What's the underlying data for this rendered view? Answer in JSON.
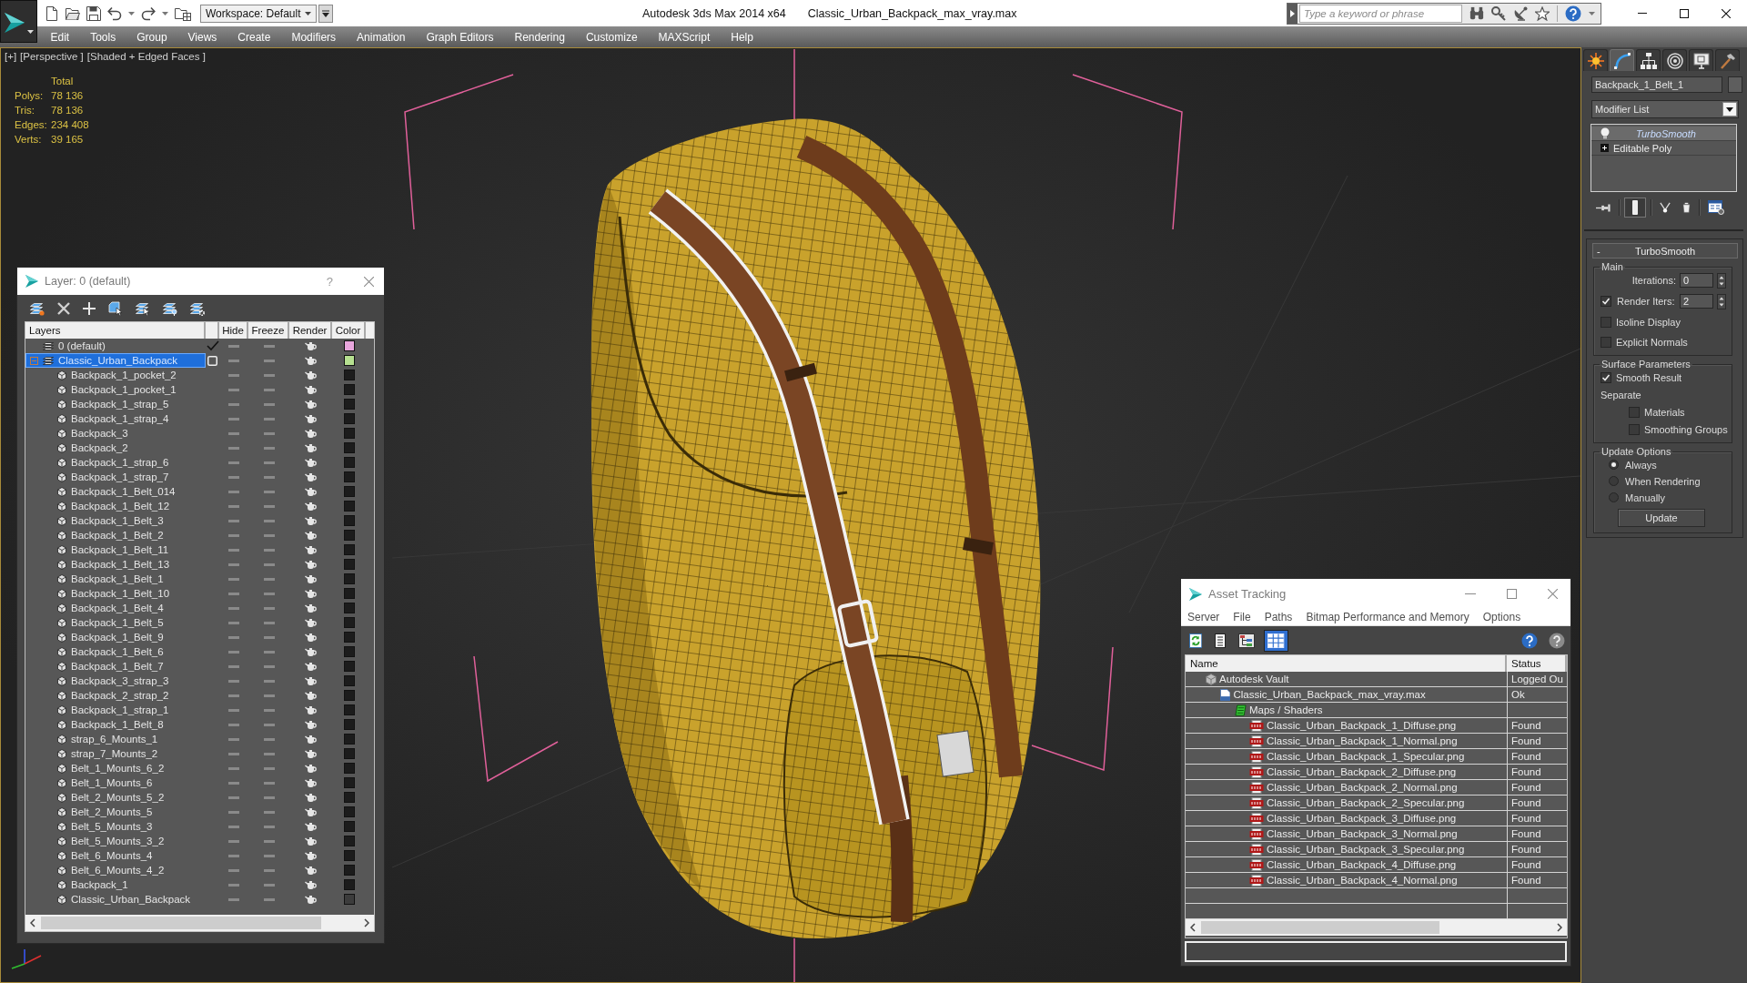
{
  "app": {
    "title": "Autodesk 3ds Max 2014 x64",
    "document": "Classic_Urban_Backpack_max_vray.max",
    "workspace": "Workspace: Default",
    "search": {
      "placeholder": "Type a keyword or phrase"
    }
  },
  "menu": [
    "Edit",
    "Tools",
    "Group",
    "Views",
    "Create",
    "Modifiers",
    "Animation",
    "Graph Editors",
    "Rendering",
    "Customize",
    "MAXScript",
    "Help"
  ],
  "viewport": {
    "labels": [
      "[+]",
      "[Perspective ]",
      "[Shaded + Edged Faces ]"
    ],
    "stats": {
      "heading": "Total",
      "rows": [
        {
          "label": "Polys:",
          "value": "78 136"
        },
        {
          "label": "Tris:",
          "value": "78 136"
        },
        {
          "label": "Edges:",
          "value": "234 408"
        },
        {
          "label": "Verts:",
          "value": "39 165"
        }
      ]
    }
  },
  "layer_window": {
    "title": "Layer: 0 (default)",
    "help": "?",
    "columns": [
      "Layers",
      "Hide",
      "Freeze",
      "Render",
      "Color"
    ],
    "layers": [
      {
        "name": "0 (default)",
        "selected": false,
        "current": true,
        "hidden": false,
        "frozen": false,
        "renderable": true,
        "color": "#e8a6dc"
      },
      {
        "name": "Classic_Urban_Backpack",
        "selected": true,
        "current": false,
        "expanded": true,
        "hidden": false,
        "frozen": false,
        "renderable": true,
        "color": "#b6e090",
        "children": [
          {
            "name": "Backpack_1_pocket_2",
            "selected": false,
            "hidden": false,
            "frozen": false,
            "renderable": true,
            "color": "#1c1c1c"
          },
          {
            "name": "Backpack_1_pocket_1",
            "selected": false,
            "hidden": false,
            "frozen": false,
            "renderable": true,
            "color": "#1c1c1c"
          },
          {
            "name": "Backpack_1_strap_5",
            "selected": false,
            "hidden": false,
            "frozen": false,
            "renderable": true,
            "color": "#1c1c1c"
          },
          {
            "name": "Backpack_1_strap_4",
            "selected": false,
            "hidden": false,
            "frozen": false,
            "renderable": true,
            "color": "#1c1c1c"
          },
          {
            "name": "Backpack_3",
            "selected": false,
            "hidden": false,
            "frozen": false,
            "renderable": true,
            "color": "#1c1c1c"
          },
          {
            "name": "Backpack_2",
            "selected": false,
            "hidden": false,
            "frozen": false,
            "renderable": true,
            "color": "#1c1c1c"
          },
          {
            "name": "Backpack_1_strap_6",
            "selected": false,
            "hidden": false,
            "frozen": false,
            "renderable": true,
            "color": "#1c1c1c"
          },
          {
            "name": "Backpack_1_strap_7",
            "selected": false,
            "hidden": false,
            "frozen": false,
            "renderable": true,
            "color": "#1c1c1c"
          },
          {
            "name": "Backpack_1_Belt_014",
            "selected": false,
            "hidden": false,
            "frozen": false,
            "renderable": true,
            "color": "#1c1c1c"
          },
          {
            "name": "Backpack_1_Belt_12",
            "selected": false,
            "hidden": false,
            "frozen": false,
            "renderable": true,
            "color": "#1c1c1c"
          },
          {
            "name": "Backpack_1_Belt_3",
            "selected": false,
            "hidden": false,
            "frozen": false,
            "renderable": true,
            "color": "#1c1c1c"
          },
          {
            "name": "Backpack_1_Belt_2",
            "selected": false,
            "hidden": false,
            "frozen": false,
            "renderable": true,
            "color": "#1c1c1c"
          },
          {
            "name": "Backpack_1_Belt_11",
            "selected": false,
            "hidden": false,
            "frozen": false,
            "renderable": true,
            "color": "#1c1c1c"
          },
          {
            "name": "Backpack_1_Belt_13",
            "selected": false,
            "hidden": false,
            "frozen": false,
            "renderable": true,
            "color": "#1c1c1c"
          },
          {
            "name": "Backpack_1_Belt_1",
            "selected": false,
            "hidden": false,
            "frozen": false,
            "renderable": true,
            "color": "#1c1c1c"
          },
          {
            "name": "Backpack_1_Belt_10",
            "selected": false,
            "hidden": false,
            "frozen": false,
            "renderable": true,
            "color": "#1c1c1c"
          },
          {
            "name": "Backpack_1_Belt_4",
            "selected": false,
            "hidden": false,
            "frozen": false,
            "renderable": true,
            "color": "#1c1c1c"
          },
          {
            "name": "Backpack_1_Belt_5",
            "selected": false,
            "hidden": false,
            "frozen": false,
            "renderable": true,
            "color": "#1c1c1c"
          },
          {
            "name": "Backpack_1_Belt_9",
            "selected": false,
            "hidden": false,
            "frozen": false,
            "renderable": true,
            "color": "#1c1c1c"
          },
          {
            "name": "Backpack_1_Belt_6",
            "selected": false,
            "hidden": false,
            "frozen": false,
            "renderable": true,
            "color": "#1c1c1c"
          },
          {
            "name": "Backpack_1_Belt_7",
            "selected": false,
            "hidden": false,
            "frozen": false,
            "renderable": true,
            "color": "#1c1c1c"
          },
          {
            "name": "Backpack_3_strap_3",
            "selected": false,
            "hidden": false,
            "frozen": false,
            "renderable": true,
            "color": "#1c1c1c"
          },
          {
            "name": "Backpack_2_strap_2",
            "selected": false,
            "hidden": false,
            "frozen": false,
            "renderable": true,
            "color": "#1c1c1c"
          },
          {
            "name": "Backpack_1_strap_1",
            "selected": false,
            "hidden": false,
            "frozen": false,
            "renderable": true,
            "color": "#1c1c1c"
          },
          {
            "name": "Backpack_1_Belt_8",
            "selected": false,
            "hidden": false,
            "frozen": false,
            "renderable": true,
            "color": "#1c1c1c"
          },
          {
            "name": "strap_6_Mounts_1",
            "selected": false,
            "hidden": false,
            "frozen": false,
            "renderable": true,
            "color": "#1c1c1c"
          },
          {
            "name": "strap_7_Mounts_2",
            "selected": false,
            "hidden": false,
            "frozen": false,
            "renderable": true,
            "color": "#1c1c1c"
          },
          {
            "name": "Belt_1_Mounts_6_2",
            "selected": false,
            "hidden": false,
            "frozen": false,
            "renderable": true,
            "color": "#1c1c1c"
          },
          {
            "name": "Belt_1_Mounts_6",
            "selected": false,
            "hidden": false,
            "frozen": false,
            "renderable": true,
            "color": "#1c1c1c"
          },
          {
            "name": "Belt_2_Mounts_5_2",
            "selected": false,
            "hidden": false,
            "frozen": false,
            "renderable": true,
            "color": "#1c1c1c"
          },
          {
            "name": "Belt_2_Mounts_5",
            "selected": false,
            "hidden": false,
            "frozen": false,
            "renderable": true,
            "color": "#1c1c1c"
          },
          {
            "name": "Belt_5_Mounts_3",
            "selected": false,
            "hidden": false,
            "frozen": false,
            "renderable": true,
            "color": "#1c1c1c"
          },
          {
            "name": "Belt_5_Mounts_3_2",
            "selected": false,
            "hidden": false,
            "frozen": false,
            "renderable": true,
            "color": "#1c1c1c"
          },
          {
            "name": "Belt_6_Mounts_4",
            "selected": false,
            "hidden": false,
            "frozen": false,
            "renderable": true,
            "color": "#1c1c1c"
          },
          {
            "name": "Belt_6_Mounts_4_2",
            "selected": false,
            "hidden": false,
            "frozen": false,
            "renderable": true,
            "color": "#1c1c1c"
          },
          {
            "name": "Backpack_1",
            "selected": false,
            "hidden": false,
            "frozen": false,
            "renderable": true,
            "color": "#1c1c1c"
          },
          {
            "name": "Classic_Urban_Backpack",
            "selected": false,
            "hidden": false,
            "frozen": false,
            "renderable": true,
            "color": "#3c3c3c"
          }
        ]
      }
    ]
  },
  "asset_tracking": {
    "title": "Asset Tracking",
    "menu": [
      "Server",
      "File",
      "Paths",
      "Bitmap Performance and Memory",
      "Options"
    ],
    "views": [
      {
        "kind": "refresh",
        "selected": false
      },
      {
        "kind": "list",
        "selected": false
      },
      {
        "kind": "tree",
        "selected": false
      },
      {
        "kind": "table",
        "selected": true
      }
    ],
    "columns": [
      "Name",
      "Status"
    ],
    "assets": [
      {
        "kind": "vault",
        "name": "Autodesk Vault",
        "status": "Logged Ou",
        "selected": false,
        "children": [
          {
            "kind": "max_file",
            "name": "Classic_Urban_Backpack_max_vray.max",
            "status": "Ok",
            "selected": false,
            "children": [
              {
                "kind": "folder",
                "name": "Maps / Shaders",
                "selected": false,
                "children": [
                  {
                    "kind": "image",
                    "name": "Classic_Urban_Backpack_1_Diffuse.png",
                    "status": "Found",
                    "selected": false
                  },
                  {
                    "kind": "image",
                    "name": "Classic_Urban_Backpack_1_Normal.png",
                    "status": "Found",
                    "selected": false
                  },
                  {
                    "kind": "image",
                    "name": "Classic_Urban_Backpack_1_Specular.png",
                    "status": "Found",
                    "selected": false
                  },
                  {
                    "kind": "image",
                    "name": "Classic_Urban_Backpack_2_Diffuse.png",
                    "status": "Found",
                    "selected": false
                  },
                  {
                    "kind": "image",
                    "name": "Classic_Urban_Backpack_2_Normal.png",
                    "status": "Found",
                    "selected": false
                  },
                  {
                    "kind": "image",
                    "name": "Classic_Urban_Backpack_2_Specular.png",
                    "status": "Found",
                    "selected": false
                  },
                  {
                    "kind": "image",
                    "name": "Classic_Urban_Backpack_3_Diffuse.png",
                    "status": "Found",
                    "selected": false
                  },
                  {
                    "kind": "image",
                    "name": "Classic_Urban_Backpack_3_Normal.png",
                    "status": "Found",
                    "selected": false
                  },
                  {
                    "kind": "image",
                    "name": "Classic_Urban_Backpack_3_Specular.png",
                    "status": "Found",
                    "selected": false
                  },
                  {
                    "kind": "image",
                    "name": "Classic_Urban_Backpack_4_Diffuse.png",
                    "status": "Found",
                    "selected": false
                  },
                  {
                    "kind": "image",
                    "name": "Classic_Urban_Backpack_4_Normal.png",
                    "status": "Found",
                    "selected": false
                  }
                ]
              }
            ]
          }
        ]
      }
    ]
  },
  "command_panel": {
    "tabs": [
      {
        "kind": "create",
        "selected": false
      },
      {
        "kind": "modify",
        "selected": true
      },
      {
        "kind": "hierarchy",
        "selected": false
      },
      {
        "kind": "motion",
        "selected": false
      },
      {
        "kind": "display",
        "selected": false
      },
      {
        "kind": "utilities",
        "selected": false
      }
    ],
    "object_name": "Backpack_1_Belt_1",
    "modifier_list": "Modifier List",
    "stack": [
      {
        "name": "TurboSmooth",
        "kind": "modifier",
        "selected": true
      },
      {
        "name": "Editable Poly",
        "kind": "base_object",
        "selected": false
      }
    ],
    "stack_tools": [
      {
        "kind": "pin",
        "on": false
      },
      {
        "kind": "end_result",
        "on": true
      },
      {
        "kind": "make_unique",
        "on": false
      },
      {
        "kind": "remove",
        "on": false
      },
      {
        "kind": "configure",
        "on": false
      }
    ],
    "rollout": {
      "title": "TurboSmooth",
      "toggle": "-",
      "groups": [
        {
          "title": "Main",
          "rows": [
            {
              "kind": "spinner",
              "label": "Iterations:",
              "value": "0"
            },
            {
              "kind": "check_spinner",
              "label": "Render Iters:",
              "value": "2",
              "checked": true
            },
            {
              "kind": "checkbox",
              "label": "Isoline Display",
              "checked": false
            },
            {
              "kind": "checkbox",
              "label": "Explicit Normals",
              "checked": false
            }
          ]
        },
        {
          "title": "Surface Parameters",
          "rows": [
            {
              "kind": "checkbox",
              "label": "Smooth Result",
              "checked": true
            },
            {
              "kind": "label",
              "label": "Separate"
            },
            {
              "kind": "sub_checkbox",
              "label": "Materials",
              "checked": false
            },
            {
              "kind": "sub_checkbox",
              "label": "Smoothing Groups",
              "checked": false
            }
          ]
        },
        {
          "title": "Update Options",
          "rows": [
            {
              "kind": "radio",
              "label": "Always",
              "selected": true
            },
            {
              "kind": "radio",
              "label": "When Rendering",
              "selected": false
            },
            {
              "kind": "radio",
              "label": "Manually",
              "selected": false
            },
            {
              "kind": "button",
              "label": "Update"
            }
          ]
        }
      ]
    }
  }
}
